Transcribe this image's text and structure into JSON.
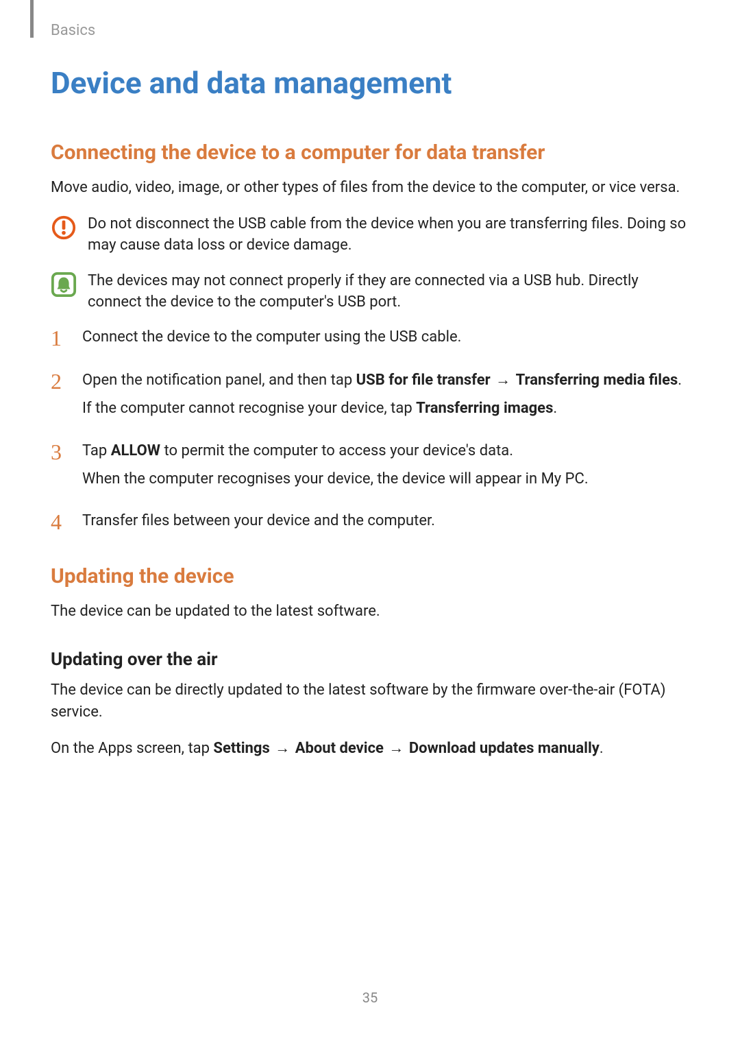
{
  "breadcrumb": "Basics",
  "page_title": "Device and data management",
  "section1": {
    "heading": "Connecting the device to a computer for data transfer",
    "intro": "Move audio, video, image, or other types of files from the device to the computer, or vice versa.",
    "warning": "Do not disconnect the USB cable from the device when you are transferring files. Doing so may cause data loss or device damage.",
    "tip": "The devices may not connect properly if they are connected via a USB hub. Directly connect the device to the computer's USB port.",
    "steps": {
      "1": {
        "num": "1",
        "text": "Connect the device to the computer using the USB cable."
      },
      "2": {
        "num": "2",
        "p1_pre": "Open the notification panel, and then tap ",
        "p1_b1": "USB for file transfer",
        "p1_mid": " → ",
        "p1_b2": "Transferring media files",
        "p1_post": ".",
        "p2_pre": "If the computer cannot recognise your device, tap ",
        "p2_b": "Transferring images",
        "p2_post": "."
      },
      "3": {
        "num": "3",
        "p1_pre": "Tap ",
        "p1_b": "ALLOW",
        "p1_post": " to permit the computer to access your device's data.",
        "p2": "When the computer recognises your device, the device will appear in My PC."
      },
      "4": {
        "num": "4",
        "text": "Transfer files between your device and the computer."
      }
    }
  },
  "section2": {
    "heading": "Updating the device",
    "intro": "The device can be updated to the latest software.",
    "sub_heading": "Updating over the air",
    "p1": "The device can be directly updated to the latest software by the firmware over-the-air (FOTA) service.",
    "p2_pre": "On the Apps screen, tap ",
    "p2_b1": "Settings",
    "p2_mid1": " → ",
    "p2_b2": "About device",
    "p2_mid2": " → ",
    "p2_b3": "Download updates manually",
    "p2_post": "."
  },
  "page_number": "35"
}
